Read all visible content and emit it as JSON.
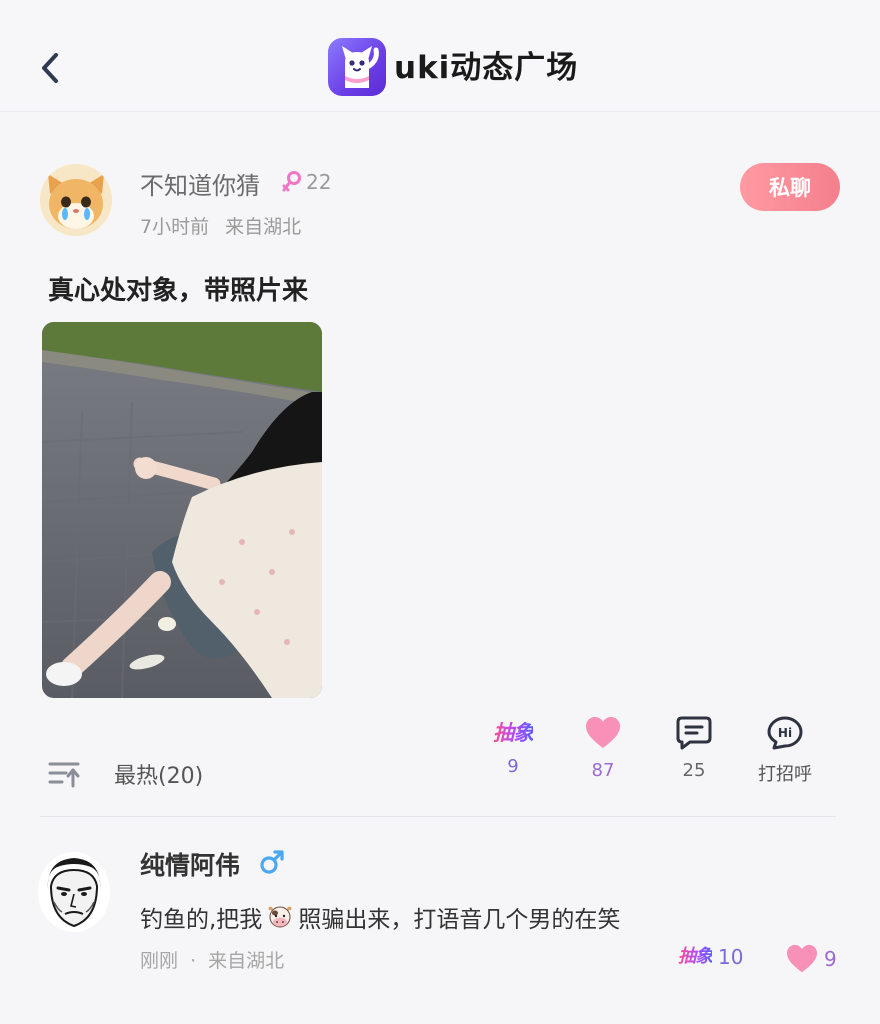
{
  "header": {
    "app_title": "uki动态广场",
    "back_icon": "chevron-left-icon",
    "logo_icon": "uki-cat-logo-icon"
  },
  "post": {
    "username": "不知道你猜",
    "gender": "female",
    "age": "22",
    "time": "7小时前",
    "location": "来自湖北",
    "dm_label": "私聊",
    "text": "真心处对象，带照片来",
    "actions": {
      "abstract": {
        "logo_text": "抽象",
        "count": "9"
      },
      "like": {
        "count": "87"
      },
      "comment": {
        "count": "25"
      },
      "hi": {
        "label": "打招呼"
      }
    },
    "sort_label": "最热(20)"
  },
  "comment": {
    "username": "纯情阿伟",
    "gender": "male",
    "text_before": "钓鱼的,把我",
    "text_emoji": "cow-emoji",
    "text_after": "照骗出来，打语音几个男的在笑",
    "time": "刚刚",
    "separator": "·",
    "location": "来自湖北",
    "abstract": {
      "logo_text": "抽象",
      "count": "10"
    },
    "like": {
      "count": "9"
    }
  },
  "colors": {
    "accent_pink": "#f57f8c",
    "like_pink": "#f990b8",
    "abstract_gradient": [
      "#ff4f8b",
      "#b04cff",
      "#5a5cff"
    ],
    "female_symbol": "#ee77c6",
    "male_symbol": "#4aa8f2"
  }
}
